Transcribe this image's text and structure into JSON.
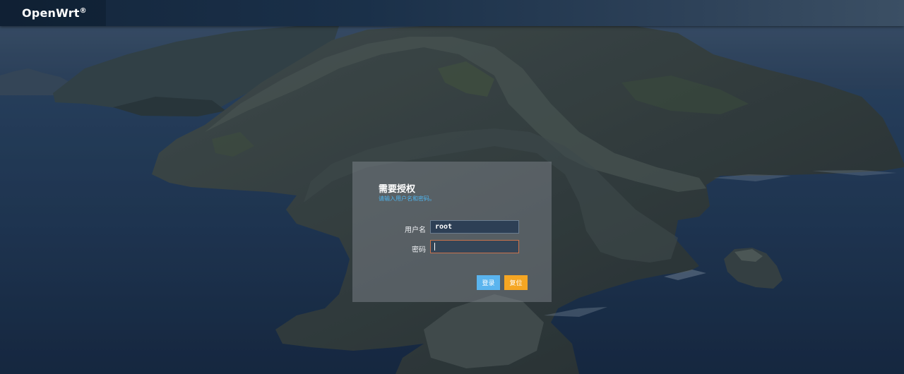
{
  "header": {
    "brand": "OpenWrt",
    "brand_mark": "®"
  },
  "login": {
    "title": "需要授权",
    "subtitle": "请输入用户名和密码。",
    "username_label": "用户名",
    "username_value": "root",
    "password_label": "密码",
    "password_value": "",
    "login_button": "登录",
    "reset_button": "复位"
  },
  "colors": {
    "accent": "#5ab4ee",
    "reset": "#f5a623",
    "subtitle": "#4fb6f0",
    "password_border": "#c9734c"
  }
}
